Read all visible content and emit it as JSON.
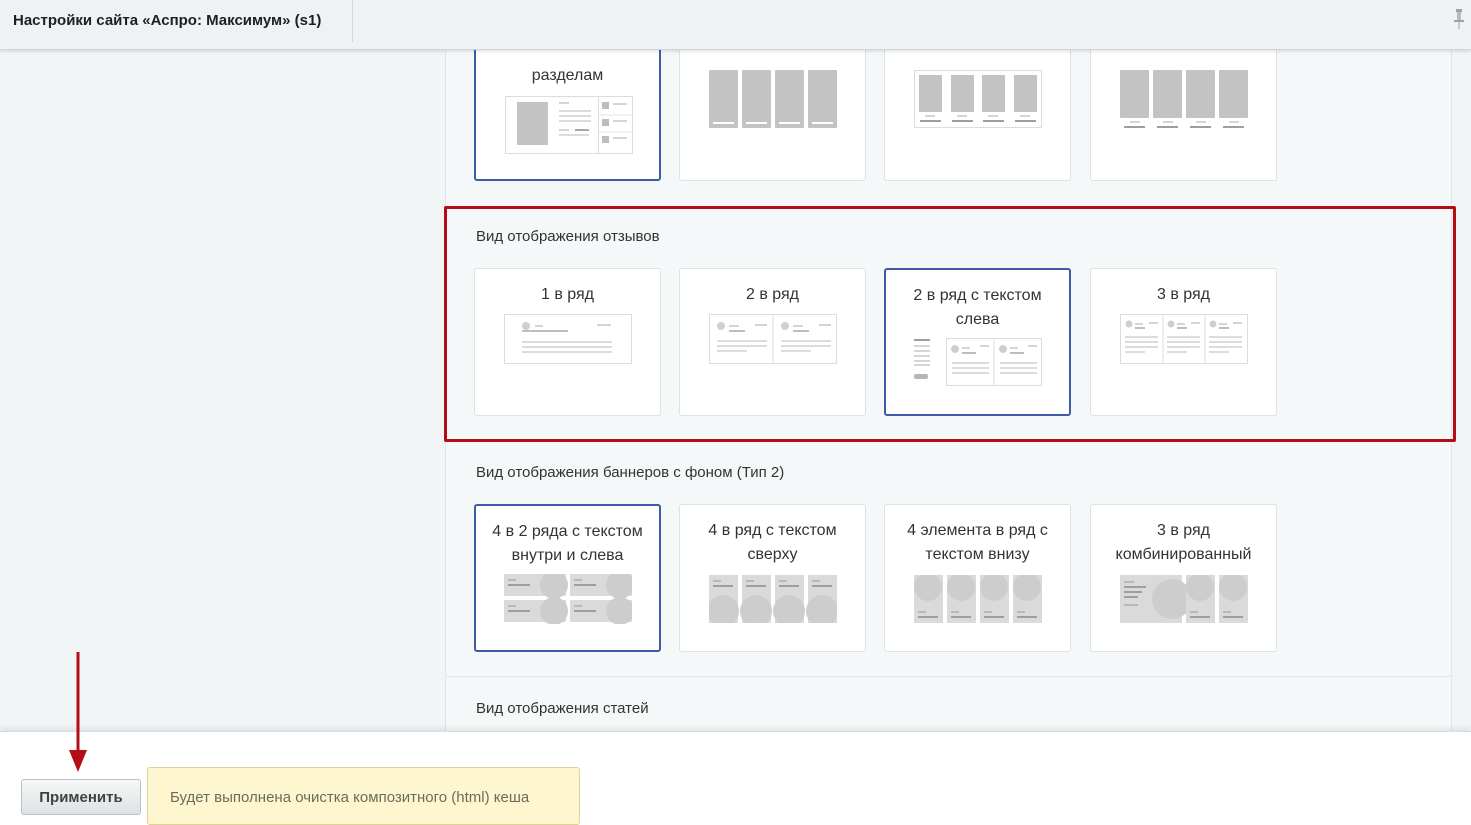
{
  "window": {
    "title": "Настройки сайта «Аспро: Максимум» (s1)"
  },
  "sections": [
    {
      "title": "",
      "options": [
        {
          "label": "разделам",
          "selected": true
        },
        {
          "label": "",
          "selected": false
        },
        {
          "label": "",
          "selected": false
        },
        {
          "label": "",
          "selected": false
        }
      ]
    },
    {
      "title": "Вид отображения отзывов",
      "options": [
        {
          "label": "1 в ряд",
          "selected": false
        },
        {
          "label": "2 в ряд",
          "selected": false
        },
        {
          "label": "2 в ряд с текстом слева",
          "selected": true
        },
        {
          "label": "3 в ряд",
          "selected": false
        }
      ]
    },
    {
      "title": "Вид отображения баннеров с фоном (Тип 2)",
      "options": [
        {
          "label": "4 в 2 ряда с текстом внутри и слева",
          "selected": true
        },
        {
          "label": "4 в ряд с текстом сверху",
          "selected": false
        },
        {
          "label": "4 элемента в ряд с текстом внизу",
          "selected": false
        },
        {
          "label": "3 в ряд комбинированный",
          "selected": false
        }
      ]
    },
    {
      "title": "Вид отображения статей"
    }
  ],
  "footer": {
    "apply_label": "Применить",
    "notice": "Будет выполнена очистка композитного (html) кеша"
  },
  "colors": {
    "selected_border": "#3d5ba6",
    "highlight": "#b30d16",
    "notice_bg": "#fdf6cf"
  }
}
